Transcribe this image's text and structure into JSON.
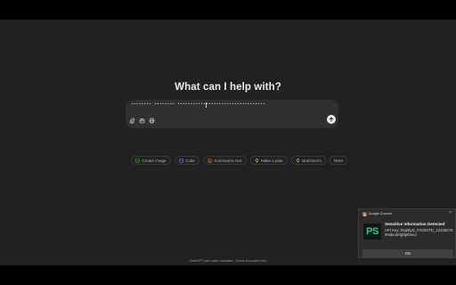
{
  "main": {
    "heading": "What can I help with?",
    "composer": {
      "value": "••••••••  ••••••••  ••••••••••••••••••••••••••••••••••"
    },
    "tools": [
      "paperclip-icon",
      "toolbox-icon",
      "globe-icon"
    ],
    "send_icon": "arrow-up-icon",
    "chips": [
      {
        "label": "Create image",
        "icon": "image-icon",
        "color": "#3fb950"
      },
      {
        "label": "Code",
        "icon": "code-icon",
        "color": "#7c8cf8"
      },
      {
        "label": "Summarize text",
        "icon": "document-icon",
        "color": "#f07a4c"
      },
      {
        "label": "Make a plan",
        "icon": "lightbulb-icon",
        "color": "#e8c547"
      },
      {
        "label": "Brainstorm",
        "icon": "lightbulb-icon",
        "color": "#e8c547"
      },
      {
        "label": "More",
        "icon": "",
        "color": ""
      }
    ],
    "footer": "ChatGPT can make mistakes. Check important info."
  },
  "notification": {
    "app": "Google Chrome",
    "title": "Sensitive Information Detected",
    "body": "API Key: h6ai9yD_FA03OTE_12345678 90abcdefghijklmno",
    "button": "OK",
    "logo_text": "PS",
    "logo_color": "#31c48d"
  }
}
